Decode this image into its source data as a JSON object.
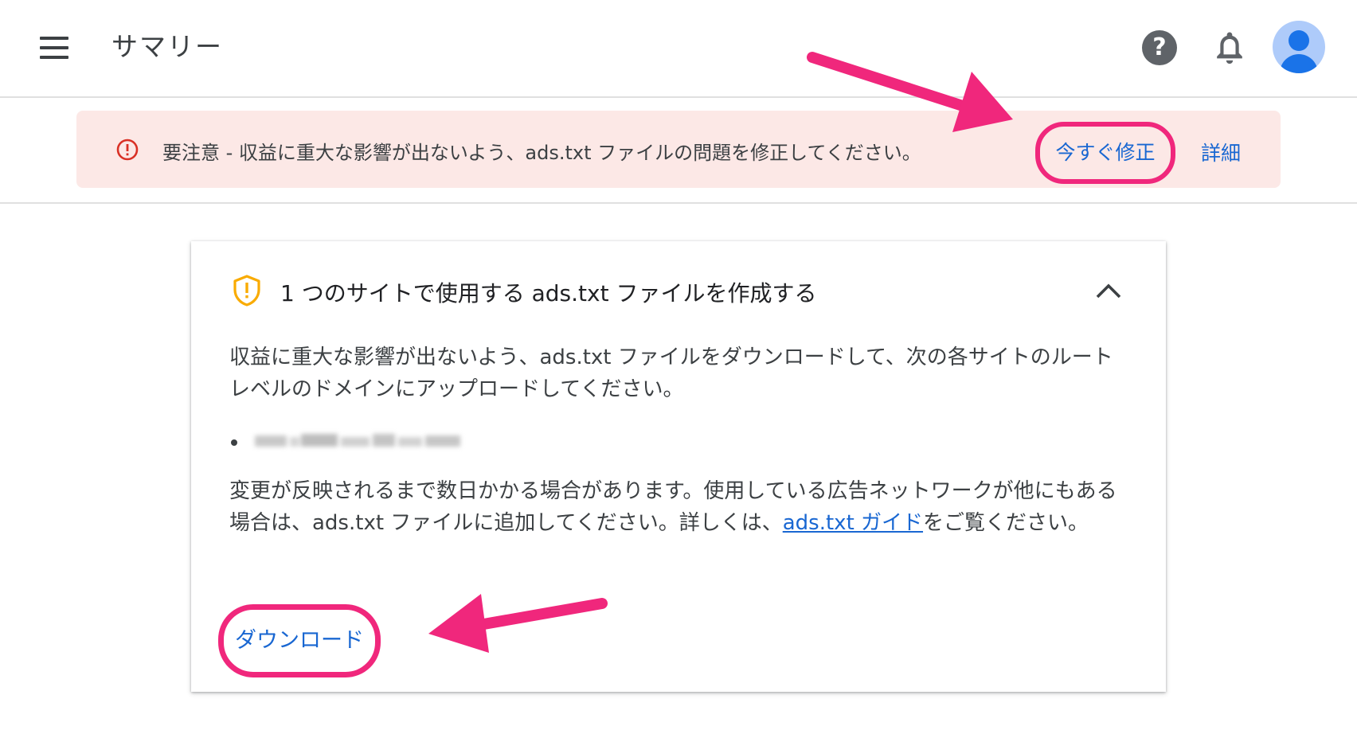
{
  "header": {
    "title": "サマリー"
  },
  "alert": {
    "text": "要注意 - 収益に重大な影響が出ないよう、ads.txt ファイルの問題を修正してください。",
    "fix_label": "今すぐ修正",
    "details_label": "詳細"
  },
  "card": {
    "title": "1 つのサイトで使用する ads.txt ファイルを作成する",
    "paragraph1": "収益に重大な影響が出ないよう、ads.txt ファイルをダウンロードして、次の各サイトのルートレベルのドメインにアップロードしてください。",
    "paragraph2_prefix": "変更が反映されるまで数日かかる場合があります。使用している広告ネットワークが他にもある場合は、ads.txt ファイルに追加してください。詳しくは、",
    "guide_link": "ads.txt ガイド",
    "paragraph2_suffix": "をご覧ください。",
    "download_label": "ダウンロード"
  },
  "colors": {
    "accent_link": "#1967d2",
    "alert_bg": "#fce8e6",
    "alert_icon": "#d93025",
    "warning_icon": "#f9ab00",
    "annotation_pink": "#f0277c"
  },
  "icons": {
    "menu": "menu-icon",
    "help": "help-icon",
    "notifications": "bell-icon",
    "account": "avatar",
    "alert": "error-circle-icon",
    "warning": "shield-warning-icon",
    "collapse": "chevron-up-icon"
  }
}
